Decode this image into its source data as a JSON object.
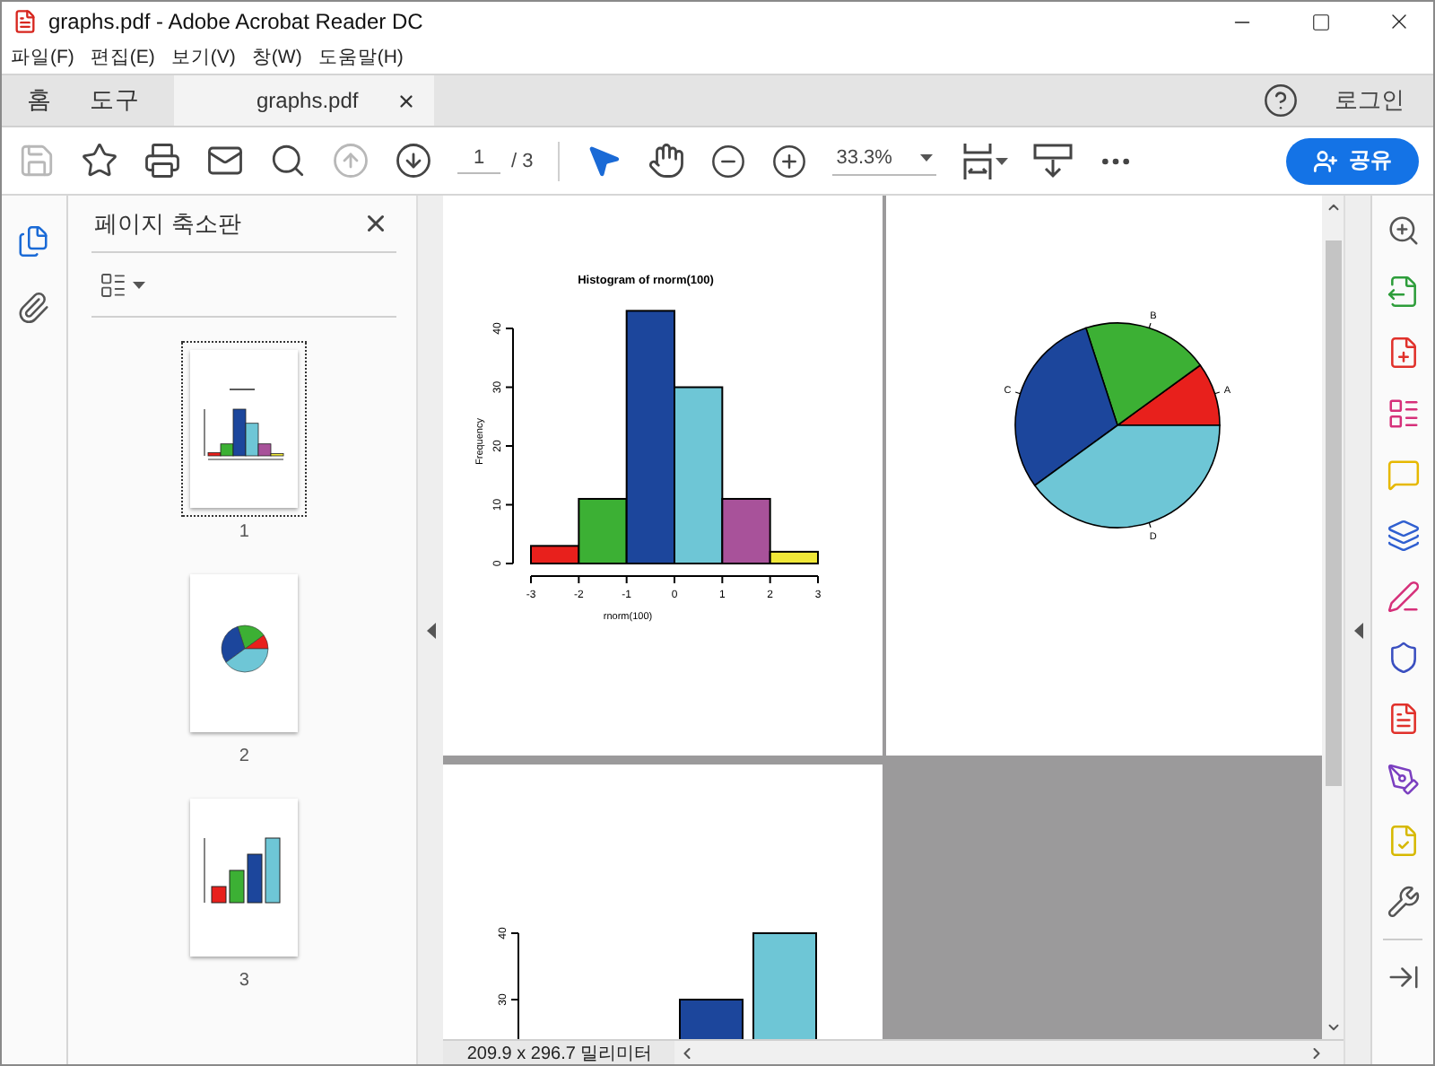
{
  "window": {
    "title": "graphs.pdf - Adobe Acrobat Reader DC"
  },
  "menu": [
    "파일(F)",
    "편집(E)",
    "보기(V)",
    "창(W)",
    "도움말(H)"
  ],
  "tabs": [
    {
      "label": "홈",
      "selected": false,
      "kind": "nav"
    },
    {
      "label": "도구",
      "selected": false,
      "kind": "nav"
    },
    {
      "label": "graphs.pdf",
      "selected": true,
      "kind": "document"
    }
  ],
  "account": {
    "label": "로그인"
  },
  "toolbar": {
    "actions": [
      {
        "kind": "save",
        "disabled": true
      },
      {
        "kind": "bookmark",
        "disabled": false
      },
      {
        "kind": "print",
        "disabled": false
      },
      {
        "kind": "email",
        "disabled": false
      },
      {
        "kind": "find",
        "disabled": false
      },
      {
        "kind": "previous-page",
        "disabled": true
      },
      {
        "kind": "next-page",
        "disabled": false
      }
    ],
    "page": "1",
    "page_total": "/ 3",
    "tools": [
      {
        "kind": "select",
        "selected": true
      },
      {
        "kind": "hand",
        "selected": false
      }
    ],
    "zoom": "33.3%",
    "share": "공유"
  },
  "left_rail": [
    {
      "kind": "pages",
      "selected": true
    },
    {
      "kind": "attachments",
      "selected": false
    }
  ],
  "thumbnails": {
    "title": "페이지 축소판",
    "pages": [
      {
        "label": "1",
        "selected": true
      },
      {
        "label": "2",
        "selected": false
      },
      {
        "label": "3",
        "selected": false
      }
    ]
  },
  "document": {
    "pages": [
      {
        "bars": [
          {
            "color": "#e8201c"
          },
          {
            "color": "#3cb034"
          },
          {
            "color": "#1c469c"
          },
          {
            "color": "#6ec6d6"
          },
          {
            "color": "#a8529a"
          },
          {
            "color": "#f0e838"
          }
        ],
        "chart_data": {
          "type": "bar",
          "title": "Histogram of rnorm(100)",
          "xlabel": "rnorm(100)",
          "ylabel": "Frequency",
          "x": [
            -2.5,
            -1.5,
            -0.5,
            0.5,
            1.5,
            2.5
          ],
          "values": [
            3,
            11,
            43,
            30,
            11,
            2
          ],
          "xlim": [
            -3,
            3
          ],
          "ylim": [
            0,
            43
          ],
          "xticks": [
            {
              "value": -3,
              "label": "-3"
            },
            {
              "value": -2,
              "label": "-2"
            },
            {
              "value": -1,
              "label": "-1"
            },
            {
              "value": 0,
              "label": "0"
            },
            {
              "value": 1,
              "label": "1"
            },
            {
              "value": 2,
              "label": "2"
            },
            {
              "value": 3,
              "label": "3"
            }
          ],
          "yticks": [
            {
              "value": 0,
              "label": "0"
            },
            {
              "value": 10,
              "label": "10"
            },
            {
              "value": 20,
              "label": "20"
            },
            {
              "value": 30,
              "label": "30"
            },
            {
              "value": 40,
              "label": "40"
            }
          ]
        }
      },
      {
        "bars": [
          {
            "color": "#e8201c"
          },
          {
            "color": "#3cb034"
          },
          {
            "color": "#1c469c"
          },
          {
            "color": "#6ec6d6"
          }
        ],
        "chart_data": {
          "type": "pie",
          "categories": [
            "A",
            "B",
            "C",
            "D"
          ],
          "values": [
            10,
            20,
            30,
            40
          ]
        }
      },
      {
        "kind": "chart-fragment",
        "bars": [
          {
            "color": "#1c469c"
          },
          {
            "color": "#6ec6d6"
          }
        ],
        "tick_labels": [
          "40",
          "30"
        ]
      }
    ]
  },
  "right_tools": [
    {
      "kind": "zoom"
    },
    {
      "kind": "export"
    },
    {
      "kind": "create"
    },
    {
      "kind": "organize"
    },
    {
      "kind": "comment"
    },
    {
      "kind": "combine"
    },
    {
      "kind": "fill-sign"
    },
    {
      "kind": "protect"
    },
    {
      "kind": "pdf"
    },
    {
      "kind": "sign"
    },
    {
      "kind": "send"
    },
    {
      "kind": "more-tools"
    },
    {
      "kind": "collapse"
    }
  ],
  "status_bar": {
    "page_size": "209.9 x 296.7 밀리미터"
  }
}
